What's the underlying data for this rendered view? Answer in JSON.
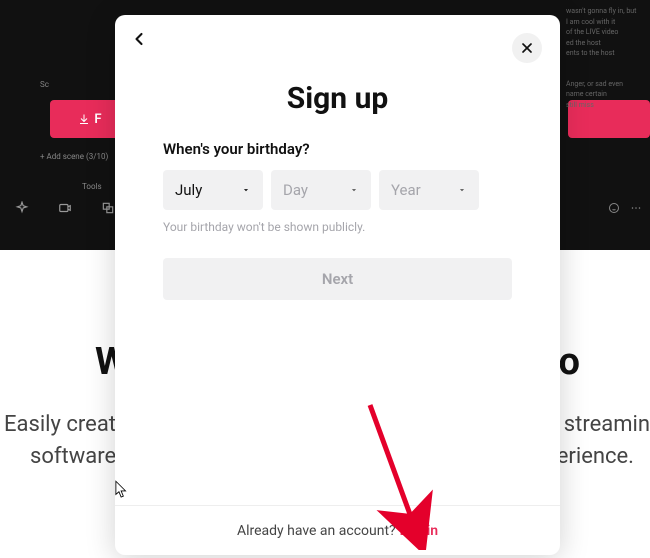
{
  "background": {
    "tools_label": "Tools",
    "add_scene": "+ Add scene (3/10)",
    "sc_label": "Sc",
    "headline_left": "W",
    "headline_right": "o",
    "sub_left_line1": "Easily creat",
    "sub_right_line1": "e streamin",
    "sub_left_line2": "software",
    "sub_right_line2": "erience.",
    "blur_lines": [
      "",
      "wasn't gonna fly in, but",
      "I am cool with it",
      "of the LIVE video",
      "ed the host",
      "ents to the host",
      "",
      "Anger, or sad even",
      "name certain",
      "still miss"
    ]
  },
  "modal": {
    "title": "Sign up",
    "birthday_label": "When's your birthday?",
    "month": {
      "value": "July"
    },
    "day": {
      "placeholder": "Day"
    },
    "year": {
      "placeholder": "Year"
    },
    "hint": "Your birthday won't be shown publicly.",
    "next": "Next",
    "footer_text": "Already have an account?",
    "login": "Log in"
  }
}
